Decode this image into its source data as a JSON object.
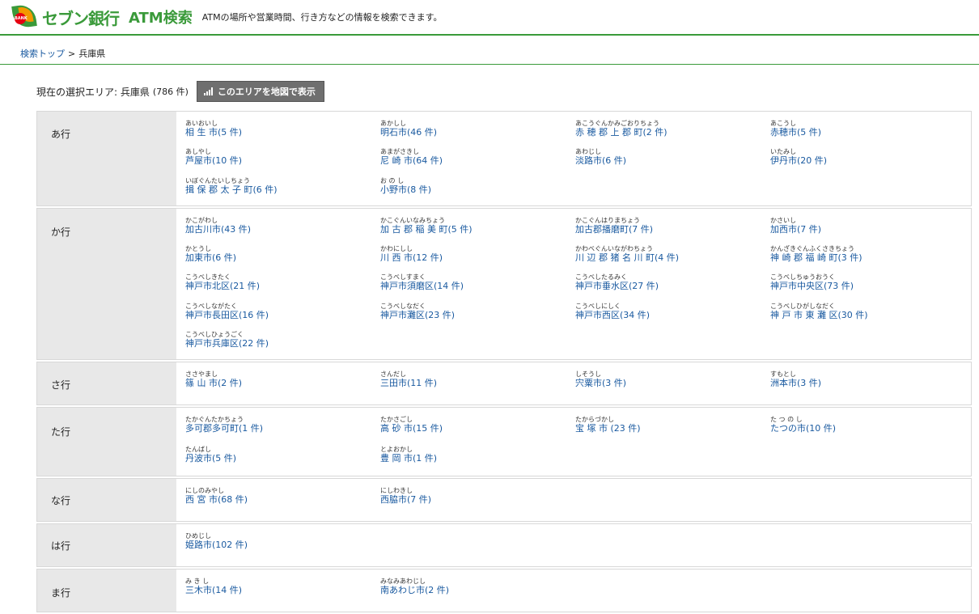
{
  "header": {
    "logo_badge": "BANK",
    "brand": "セブン銀行",
    "title": "ATM検索",
    "tagline": "ATMの場所や営業時間、行き方などの情報を検索できます。"
  },
  "breadcrumb": {
    "top": "検索トップ",
    "separator": ">",
    "current": "兵庫県"
  },
  "selection": {
    "label": "現在の選択エリア: 兵庫県",
    "count": "(786 件)",
    "map_button": "このエリアを地図で表示"
  },
  "rows": [
    {
      "head": "あ行",
      "items": [
        {
          "ruby": "あいおいし",
          "name": "相 生 市(5 件)"
        },
        {
          "ruby": "あかしし",
          "name": "明石市(46 件)"
        },
        {
          "ruby": "あこうぐんかみごおりちょう",
          "name": "赤 穂 郡 上 郡 町(2 件)"
        },
        {
          "ruby": "あこうし",
          "name": "赤穂市(5 件)"
        },
        {
          "ruby": "あしやし",
          "name": "芦屋市(10 件)"
        },
        {
          "ruby": "あまがさきし",
          "name": "尼 崎 市(64 件)"
        },
        {
          "ruby": "あわじし",
          "name": "淡路市(6 件)"
        },
        {
          "ruby": "いたみし",
          "name": "伊丹市(20 件)"
        },
        {
          "ruby": "いぼぐんたいしちょう",
          "name": "揖 保 郡 太 子 町(6 件)"
        },
        {
          "ruby": "お の し",
          "name": "小野市(8 件)"
        }
      ]
    },
    {
      "head": "か行",
      "items": [
        {
          "ruby": "かこがわし",
          "name": "加古川市(43 件)"
        },
        {
          "ruby": "かこぐんいなみちょう",
          "name": "加 古 郡 稲 美 町(5 件)"
        },
        {
          "ruby": "かこぐんはりまちょう",
          "name": "加古郡播磨町(7 件)"
        },
        {
          "ruby": "かさいし",
          "name": "加西市(7 件)"
        },
        {
          "ruby": "かとうし",
          "name": "加東市(6 件)"
        },
        {
          "ruby": "かわにしし",
          "name": "川 西 市(12 件)"
        },
        {
          "ruby": "かわべぐんいながわちょう",
          "name": "川 辺 郡 猪 名 川 町(4 件)"
        },
        {
          "ruby": "かんざきぐんふくさきちょう",
          "name": "神 崎 郡 福 崎 町(3 件)"
        },
        {
          "ruby": "こうべしきたく",
          "name": "神戸市北区(21 件)"
        },
        {
          "ruby": "こうべしすまく",
          "name": "神戸市須磨区(14 件)"
        },
        {
          "ruby": "こうべしたるみく",
          "name": "神戸市垂水区(27 件)"
        },
        {
          "ruby": "こうべしちゅうおうく",
          "name": "神戸市中央区(73 件)"
        },
        {
          "ruby": "こうべしながたく",
          "name": "神戸市長田区(16 件)"
        },
        {
          "ruby": "こうべしなだく",
          "name": "神戸市灘区(23 件)"
        },
        {
          "ruby": "こうべしにしく",
          "name": "神戸市西区(34 件)"
        },
        {
          "ruby": "こうべしひがしなだく",
          "name": "神 戸 市 東 灘 区(30 件)"
        },
        {
          "ruby": "こうべしひょうごく",
          "name": "神戸市兵庫区(22 件)"
        }
      ]
    },
    {
      "head": "さ行",
      "items": [
        {
          "ruby": "ささやまし",
          "name": "篠 山 市(2 件)"
        },
        {
          "ruby": "さんだし",
          "name": "三田市(11 件)"
        },
        {
          "ruby": "しそうし",
          "name": "宍粟市(3 件)"
        },
        {
          "ruby": "すもとし",
          "name": "洲本市(3 件)"
        }
      ]
    },
    {
      "head": "た行",
      "items": [
        {
          "ruby": "たかぐんたかちょう",
          "name": "多可郡多可町(1 件)"
        },
        {
          "ruby": "たかさごし",
          "name": "高 砂 市(15 件)"
        },
        {
          "ruby": "たからづかし",
          "name": "宝 塚 市 (23 件)"
        },
        {
          "ruby": "た つ の し",
          "name": "たつの市(10 件)"
        },
        {
          "ruby": "たんばし",
          "name": "丹波市(5 件)"
        },
        {
          "ruby": "とよおかし",
          "name": "豊 岡 市(1 件)"
        }
      ]
    },
    {
      "head": "な行",
      "items": [
        {
          "ruby": "にしのみやし",
          "name": "西 宮 市(68 件)"
        },
        {
          "ruby": "にしわきし",
          "name": "西脇市(7 件)"
        }
      ]
    },
    {
      "head": "は行",
      "items": [
        {
          "ruby": "ひめじし",
          "name": "姫路市(102 件)"
        }
      ]
    },
    {
      "head": "ま行",
      "items": [
        {
          "ruby": "み き し",
          "name": "三木市(14 件)"
        },
        {
          "ruby": "みなみあわじし",
          "name": "南あわじ市(2 件)"
        }
      ]
    }
  ]
}
